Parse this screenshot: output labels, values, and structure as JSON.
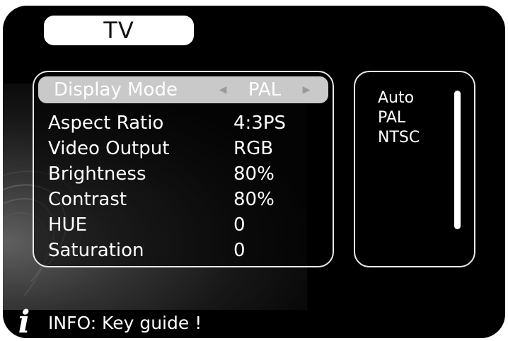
{
  "header": {
    "tab_label": "TV"
  },
  "menu": {
    "items": [
      {
        "label": "Display Mode",
        "value": "PAL",
        "selected": true
      },
      {
        "label": "Aspect Ratio",
        "value": "4:3PS"
      },
      {
        "label": "Video Output",
        "value": "RGB"
      },
      {
        "label": "Brightness",
        "value": "80%"
      },
      {
        "label": "Contrast",
        "value": "80%"
      },
      {
        "label": "HUE",
        "value": "0"
      },
      {
        "label": "Saturation",
        "value": "0"
      }
    ],
    "arrow_left_icon": "◀",
    "arrow_right_icon": "▶"
  },
  "options": {
    "items": [
      "Auto",
      "PAL",
      "NTSC"
    ]
  },
  "info": {
    "icon": "i",
    "text": "INFO: Key guide !"
  }
}
